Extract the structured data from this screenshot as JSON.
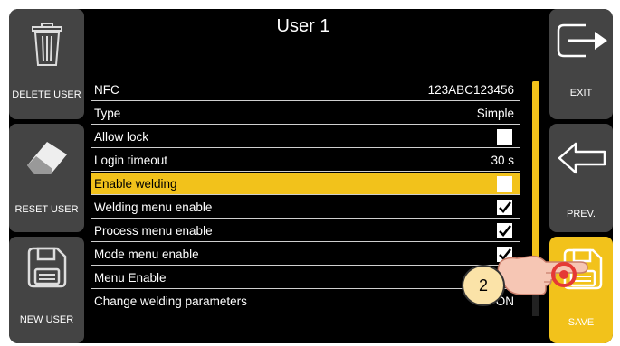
{
  "screen_title": "User 1",
  "left_buttons": {
    "delete": "DELETE USER",
    "reset": "RESET USER",
    "new": "NEW USER"
  },
  "right_buttons": {
    "exit": "EXIT",
    "prev": "PREV.",
    "save": "SAVE"
  },
  "rows": [
    {
      "label": "NFC",
      "value": "123ABC123456"
    },
    {
      "label": "Type",
      "value": "Simple"
    },
    {
      "label": "Allow lock",
      "checked": false
    },
    {
      "label": "Login timeout",
      "value": "30 s"
    },
    {
      "label": "Enable welding",
      "checked": false,
      "highlighted": true
    },
    {
      "label": "Welding menu enable",
      "checked": true
    },
    {
      "label": "Process menu enable",
      "checked": true
    },
    {
      "label": "Mode menu enable",
      "checked": true
    },
    {
      "label": "Menu Enable",
      "checked": true
    },
    {
      "label": "Change welding parameters",
      "value": "ON"
    }
  ],
  "callout": {
    "number": "2"
  },
  "colors": {
    "accent": "#f2c21b",
    "screen_bg": "#000000",
    "button_bg": "#444444",
    "save_bg": "#f2c21b"
  },
  "icons": [
    "trash-icon",
    "eraser-icon",
    "floppy-disk-icon",
    "exit-arrow-icon",
    "back-arrow-icon",
    "save-floppy-icon",
    "pointing-hand-icon",
    "checkmark-icon"
  ]
}
